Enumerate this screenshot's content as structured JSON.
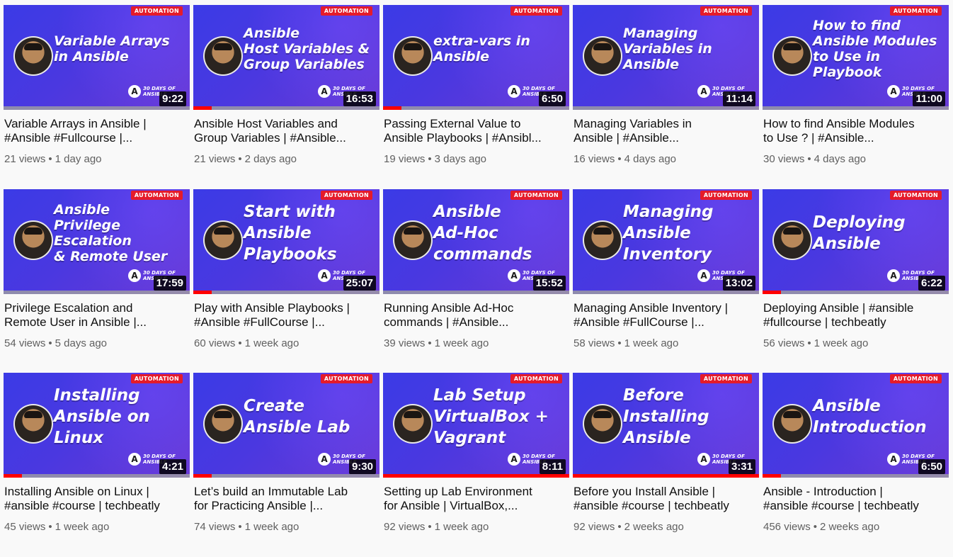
{
  "videos": [
    {
      "thumb_title": "Variable Arrays\nin Ansible",
      "badge": "AUTOMATION",
      "series": "30 DAYS OF\nANSIBLE",
      "duration": "9:22",
      "progress": 0,
      "title_line1": "Variable Arrays in Ansible |",
      "title_line2": "#Ansible #Fullcourse |...",
      "views": "21 views",
      "age": "1 day ago"
    },
    {
      "thumb_title": "Ansible\nHost Variables &\nGroup Variables",
      "badge": "AUTOMATION",
      "series": "30 DAYS OF\nANSIBLE",
      "duration": "16:53",
      "progress": 0.1,
      "title_line1": "Ansible Host Variables and",
      "title_line2": "Group Variables | #Ansible...",
      "views": "21 views",
      "age": "2 days ago"
    },
    {
      "thumb_title": "extra-vars in\nAnsible",
      "badge": "AUTOMATION",
      "series": "30 DAYS OF\nANSIBLE",
      "duration": "6:50",
      "progress": 0.1,
      "title_line1": "Passing External Value to",
      "title_line2": "Ansible Playbooks | #Ansibl...",
      "views": "19 views",
      "age": "3 days ago"
    },
    {
      "thumb_title": "Managing\nVariables in\nAnsible",
      "badge": "AUTOMATION",
      "series": "30 DAYS OF\nANSIBLE",
      "duration": "11:14",
      "progress": 0,
      "title_line1": "Managing Variables in",
      "title_line2": "Ansible | #Ansible...",
      "views": "16 views",
      "age": "4 days ago"
    },
    {
      "thumb_title": "How to find\nAnsible Modules\nto Use in Playbook",
      "badge": "AUTOMATION",
      "series": "30 DAYS OF\nANSIBLE",
      "duration": "11:00",
      "progress": 0,
      "title_line1": "How to find Ansible Modules",
      "title_line2": "to Use ? | #Ansible...",
      "views": "30 views",
      "age": "4 days ago"
    },
    {
      "thumb_title": "Ansible\nPrivilege Escalation\n& Remote User",
      "badge": "AUTOMATION",
      "series": "30 DAYS OF\nANSIBLE",
      "duration": "17:59",
      "progress": 0,
      "title_line1": "Privilege Escalation and",
      "title_line2": "Remote User in Ansible |...",
      "views": "54 views",
      "age": "5 days ago"
    },
    {
      "thumb_title": "Start with\nAnsible\nPlaybooks",
      "badge": "AUTOMATION",
      "series": "30 DAYS OF\nANSIBLE",
      "duration": "25:07",
      "progress": 0.1,
      "title_line1": "Play with Ansible Playbooks |",
      "title_line2": "#Ansible #FullCourse |...",
      "views": "60 views",
      "age": "1 week ago",
      "big": true
    },
    {
      "thumb_title": "Ansible\nAd-Hoc\ncommands",
      "badge": "AUTOMATION",
      "series": "30 DAYS OF\nANSIBLE",
      "duration": "15:52",
      "progress": 0,
      "title_line1": "Running Ansible Ad-Hoc",
      "title_line2": "commands | #Ansible...",
      "views": "39 views",
      "age": "1 week ago",
      "big": true
    },
    {
      "thumb_title": "Managing\nAnsible\nInventory",
      "badge": "AUTOMATION",
      "series": "30 DAYS OF\nANSIBLE",
      "duration": "13:02",
      "progress": 0,
      "title_line1": "Managing Ansible Inventory |",
      "title_line2": "#Ansible #FullCourse |...",
      "views": "58 views",
      "age": "1 week ago",
      "big": true
    },
    {
      "thumb_title": "Deploying\nAnsible",
      "badge": "AUTOMATION",
      "series": "30 DAYS OF\nANSIBLE",
      "duration": "6:22",
      "progress": 0.1,
      "title_line1": "Deploying Ansible | #ansible",
      "title_line2": "#fullcourse | techbeatly",
      "views": "56 views",
      "age": "1 week ago",
      "big": true
    },
    {
      "thumb_title": "Installing\nAnsible on\nLinux",
      "badge": "AUTOMATION",
      "series": "30 DAYS OF\nANSIBLE",
      "duration": "4:21",
      "progress": 0.1,
      "title_line1": "Installing Ansible on Linux |",
      "title_line2": "#ansible #course | techbeatly",
      "views": "45 views",
      "age": "1 week ago",
      "big": true
    },
    {
      "thumb_title": "Create\nAnsible Lab",
      "badge": "AUTOMATION",
      "series": "30 DAYS OF\nANSIBLE",
      "duration": "9:30",
      "progress": 0.1,
      "title_line1": "Let’s build an Immutable Lab",
      "title_line2": "for Practicing Ansible |...",
      "views": "74 views",
      "age": "1 week ago",
      "big": true
    },
    {
      "thumb_title": "Lab Setup\nVirtualBox +\nVagrant",
      "badge": "AUTOMATION",
      "series": "30 DAYS OF\nANSIBLE",
      "duration": "8:11",
      "progress": 1,
      "title_line1": "Setting up Lab Environment",
      "title_line2": "for Ansible | VirtualBox,...",
      "views": "92 views",
      "age": "1 week ago",
      "big": true
    },
    {
      "thumb_title": "Before\nInstalling\nAnsible",
      "badge": "AUTOMATION",
      "series": "30 DAYS OF\nANSIBLE",
      "duration": "3:31",
      "progress": 1,
      "title_line1": "Before you Install Ansible |",
      "title_line2": "#ansible #course | techbeatly",
      "views": "92 views",
      "age": "2 weeks ago",
      "big": true
    },
    {
      "thumb_title": "Ansible\nIntroduction",
      "badge": "AUTOMATION",
      "series": "30 DAYS OF\nANSIBLE",
      "duration": "6:50",
      "progress": 0.1,
      "title_line1": "Ansible - Introduction |",
      "title_line2": "#ansible #course | techbeatly",
      "views": "456 views",
      "age": "2 weeks ago",
      "big": true
    }
  ]
}
